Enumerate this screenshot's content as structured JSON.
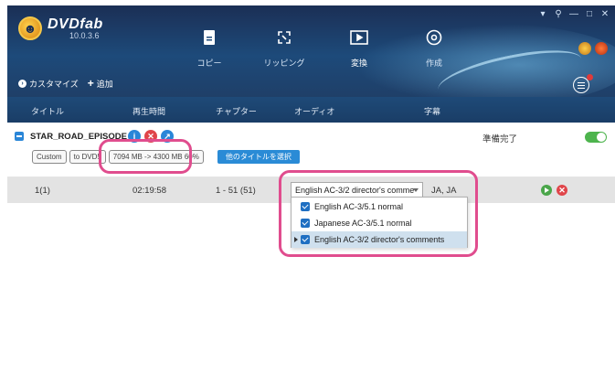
{
  "app": {
    "name": "DVDfab",
    "version": "10.0.3.6",
    "window_controls": [
      "▾",
      "⚲",
      "—",
      "□",
      "✕"
    ]
  },
  "nav": [
    {
      "label": "コピー",
      "icon": "copy-icon"
    },
    {
      "label": "リッピング",
      "icon": "ripping-icon"
    },
    {
      "label": "変換",
      "icon": "convert-icon"
    },
    {
      "label": "作成",
      "icon": "create-icon"
    }
  ],
  "toolbar": {
    "customize_label": "カスタマイズ",
    "add_label": "追加"
  },
  "columns": {
    "title": "タイトル",
    "duration": "再生時間",
    "chapter": "チャプター",
    "audio": "オーディオ",
    "subtitle": "字幕"
  },
  "title_item": {
    "name": "STAR_ROAD_EPISODE III",
    "status": "準備完了",
    "tags": [
      "Custom",
      "to DVD5",
      "7094 MB -> 4300 MB 60%"
    ],
    "select_other_label": "他のタイトルを選択"
  },
  "track": {
    "title": "1(1)",
    "duration": "02:19:58",
    "chapters": "1 - 51 (51)",
    "audio_selected": "English AC-3/2 director's comme",
    "subtitle": "JA, JA"
  },
  "audio_options": [
    {
      "label": "English AC-3/5.1 normal",
      "checked": true
    },
    {
      "label": "Japanese AC-3/5.1 normal",
      "checked": true
    },
    {
      "label": "English AC-3/2 director's comments",
      "checked": true
    }
  ],
  "colors": {
    "header": "#1d4a7a",
    "accent_blue": "#2a86d8",
    "highlight": "#e04d8e",
    "toggle_on": "#4db44d"
  }
}
